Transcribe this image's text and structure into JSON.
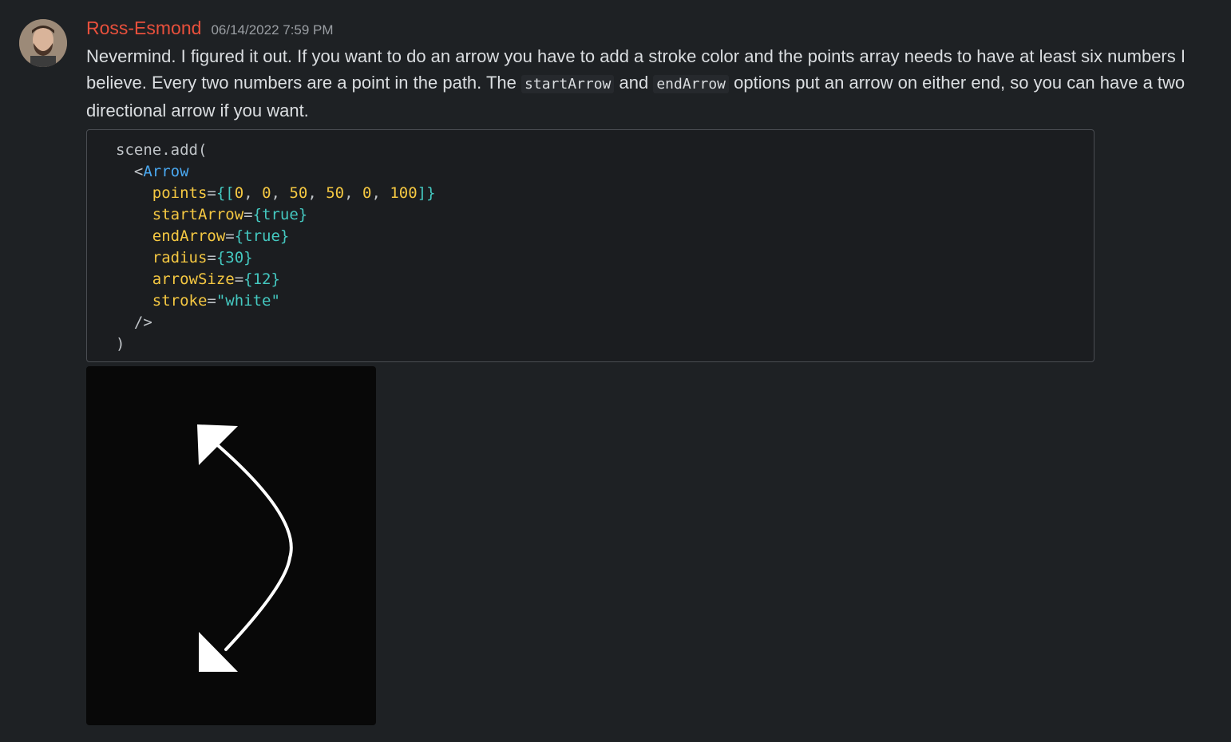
{
  "message": {
    "author": "Ross-Esmond",
    "timestamp": "06/14/2022 7:59 PM",
    "text_part1": "Nevermind. I figured it out. If you want to do an arrow you have to add a stroke color and the points array needs to have at least six numbers I believe. Every two numbers are a point in the path. The ",
    "code_start_arrow": "startArrow",
    "text_and": " and ",
    "code_end_arrow": "endArrow",
    "text_part2": " options put an arrow on either end, so you can have a two directional arrow if you want."
  },
  "code": {
    "l1": "scene.add(",
    "l2_open": "<",
    "l2_tag": "Arrow",
    "l3_attr": "points",
    "l3_eq": "=",
    "l3_open": "{[",
    "l3_n1": "0",
    "l3_n2": "0",
    "l3_n3": "50",
    "l3_n4": "50",
    "l3_n5": "0",
    "l3_n6": "100",
    "l3_close": "]}",
    "l4_attr": "startArrow",
    "l4_val": "{true}",
    "l5_attr": "endArrow",
    "l5_val": "{true}",
    "l6_attr": "radius",
    "l6_val": "{30}",
    "l7_attr": "arrowSize",
    "l7_val": "{12}",
    "l8_attr": "stroke",
    "l8_val": "\"white\"",
    "l9": "/>",
    "l10": ")"
  },
  "colors": {
    "background": "#1e2124",
    "username": "#e8503c",
    "code_tag": "#4aa8f0",
    "code_attr": "#f5c842",
    "code_value": "#44c8c0"
  },
  "icons": [
    "avatar-photo",
    "double-headed-curved-arrow-image"
  ]
}
